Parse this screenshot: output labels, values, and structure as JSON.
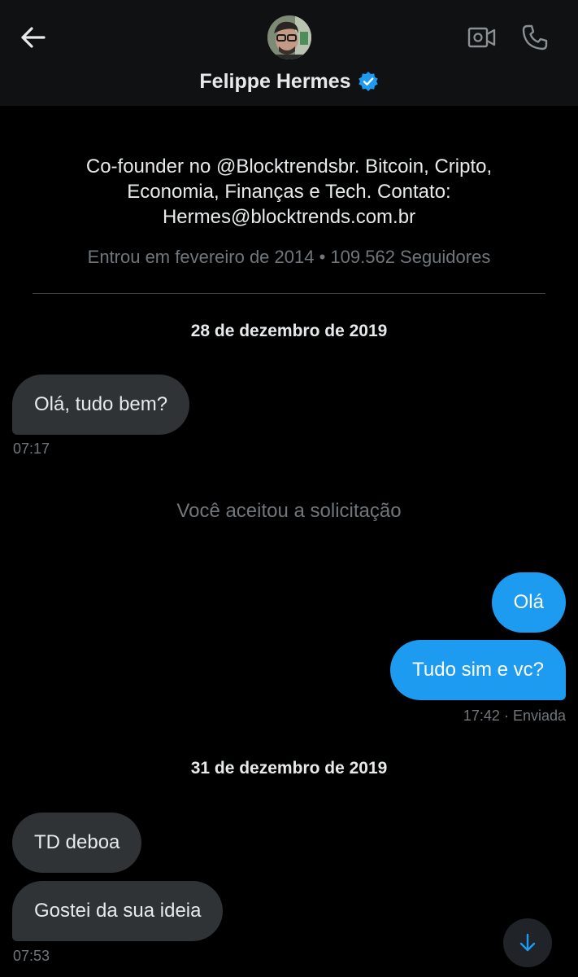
{
  "header": {
    "name": "Felippe Hermes",
    "icons": {
      "back": "arrow-left-icon",
      "verified": "verified-badge-icon",
      "video": "video-call-icon",
      "phone": "phone-icon"
    }
  },
  "profile": {
    "bio_line1": "Co-founder no @Blocktrendsbr. Bitcoin, Cripto,",
    "bio_line2": "Economia, Finanças e Tech. Contato:",
    "bio_line3": "Hermes@blocktrends.com.br",
    "meta": "Entrou em fevereiro de 2014 • 109.562 Seguidores"
  },
  "conversation": {
    "date_1": "28 de dezembro de 2019",
    "msg_1": {
      "text": "Olá, tudo bem?",
      "time": "07:17"
    },
    "notice": "Você aceitou a solicitação",
    "msg_2": {
      "text": "Olá"
    },
    "msg_3": {
      "text": "Tudo sim e vc?",
      "time": "17:42",
      "status": "· Enviada"
    },
    "date_2": "31 de dezembro de 2019",
    "msg_4": {
      "text": "TD deboa"
    },
    "msg_5": {
      "text": "Gostei da sua ideia",
      "time": "07:53"
    }
  },
  "colors": {
    "background": "#000000",
    "header": "#101112",
    "incoming_bubble": "#2f3336",
    "outgoing_bubble": "#1d9bf0",
    "muted_text": "#71767b",
    "accent": "#1d9bf0"
  }
}
